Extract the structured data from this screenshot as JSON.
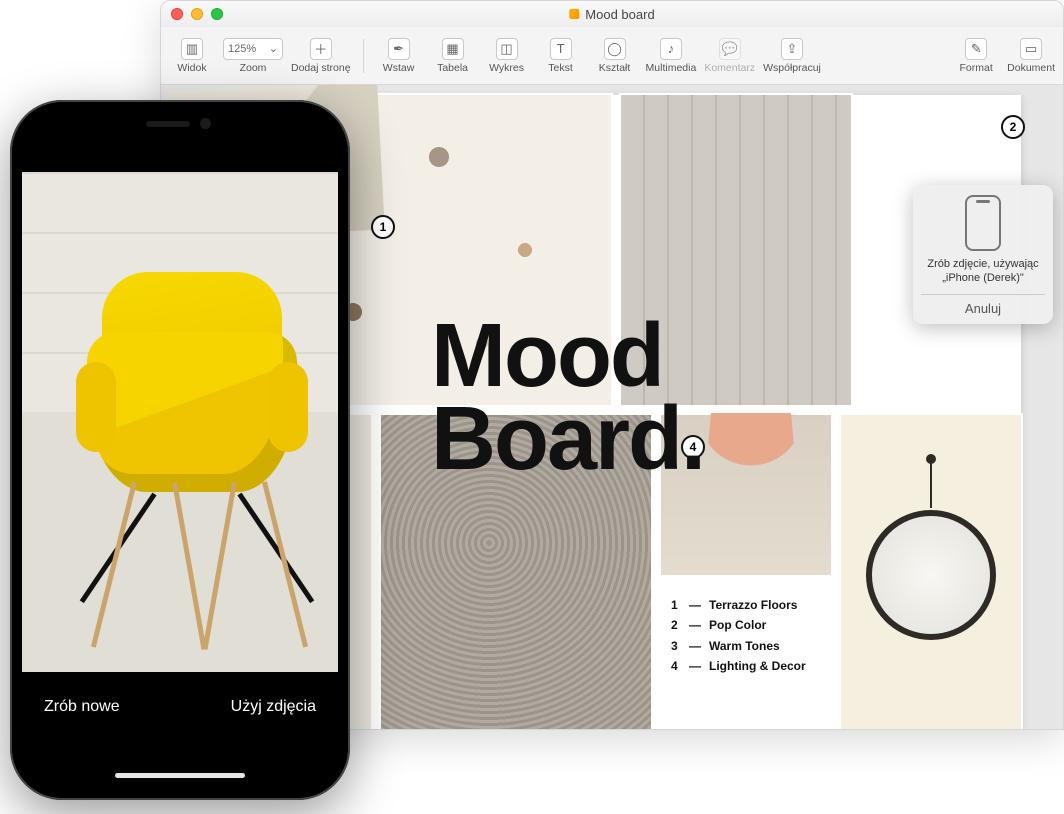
{
  "window": {
    "title": "Mood board"
  },
  "toolbar": {
    "view": "Widok",
    "zoom_value": "125%",
    "zoom_label": "Zoom",
    "add_page": "Dodaj stronę",
    "insert": "Wstaw",
    "table": "Tabela",
    "chart": "Wykres",
    "text": "Tekst",
    "shape": "Kształt",
    "media": "Multimedia",
    "comment": "Komentarz",
    "share": "Współpracuj",
    "format": "Format",
    "document": "Dokument"
  },
  "moodboard": {
    "title_line1": "Mood",
    "title_line2": "Board.",
    "badges": {
      "b1": "1",
      "b2": "2",
      "b4": "4"
    },
    "legend": [
      {
        "num": "1",
        "text": "Terrazzo Floors"
      },
      {
        "num": "2",
        "text": "Pop Color"
      },
      {
        "num": "3",
        "text": "Warm Tones"
      },
      {
        "num": "4",
        "text": "Lighting & Decor"
      }
    ]
  },
  "popover": {
    "message": "Zrób zdjęcie, używając „iPhone (Derek)\"",
    "cancel": "Anuluj"
  },
  "iphone": {
    "retake": "Zrób nowe",
    "use_photo": "Użyj zdjęcia"
  }
}
